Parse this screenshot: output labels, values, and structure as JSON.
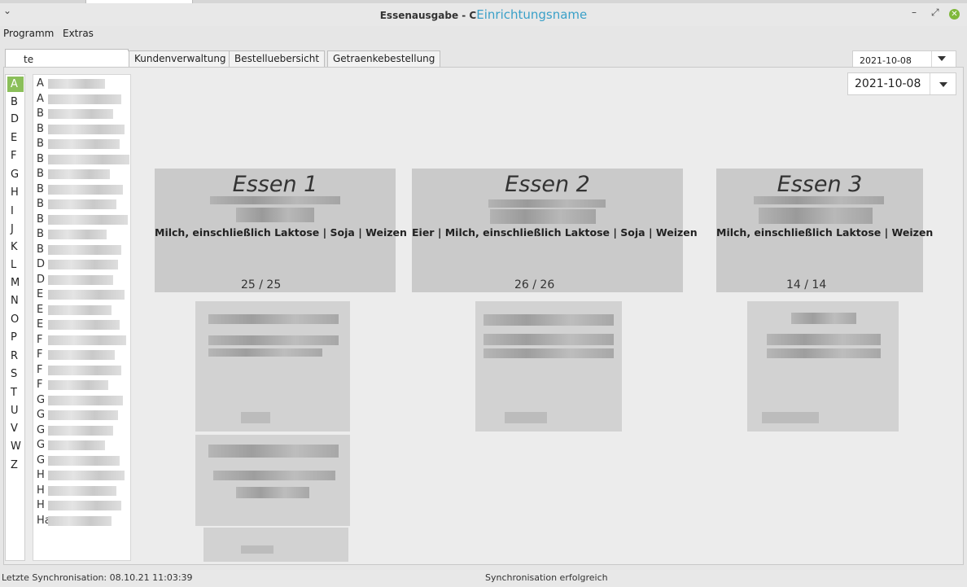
{
  "window": {
    "title": "Essenausgabe - C",
    "title_suffix": "Einrichtungsname"
  },
  "menu": [
    "Programm",
    "Extras"
  ],
  "tabs": {
    "active_label": "te",
    "items": [
      "Kundenverwaltung",
      "Bestelluebersicht",
      "Getraenkebestellung"
    ]
  },
  "date_primary": "2021-10-08",
  "date_secondary": "2021-10-08",
  "letters": [
    "A",
    "B",
    "D",
    "E",
    "F",
    "G",
    "H",
    "I",
    "J",
    "K",
    "L",
    "M",
    "N",
    "O",
    "P",
    "R",
    "S",
    "T",
    "U",
    "V",
    "W",
    "Z"
  ],
  "selected_letter": "A",
  "name_initials": [
    "A",
    "A",
    "B",
    "B",
    "B",
    "B",
    "B",
    "B",
    "B",
    "B",
    "B",
    "B",
    "D",
    "D",
    "E",
    "E",
    "E",
    "F",
    "F",
    "F",
    "F",
    "G",
    "G",
    "G",
    "G",
    "G",
    "H",
    "H",
    "H",
    "Ha"
  ],
  "meals": [
    {
      "title": "Essen 1",
      "allergens": "Milch, einschließlich Laktose | Soja | Weizen",
      "count": "25 / 25"
    },
    {
      "title": "Essen 2",
      "allergens": "Eier | Milch, einschließlich Laktose | Soja | Weizen",
      "count": "26 / 26"
    },
    {
      "title": "Essen 3",
      "allergens": "Milch, einschließlich Laktose | Weizen",
      "count": "14 / 14"
    }
  ],
  "status": {
    "last_sync": "Letzte Synchronisation: 08.10.21 11:03:39",
    "message": "Synchronisation erfolgreich"
  },
  "icons": {
    "window_menu": "chevron-down-icon",
    "minimize": "minimize-icon",
    "maximize": "maximize-icon",
    "close": "close-icon"
  },
  "colors": {
    "selected_letter_bg": "#8bbf5a",
    "close_button": "#7fb83a",
    "title_suffix": "#3aa0c8",
    "card_bg": "#cacaca"
  }
}
